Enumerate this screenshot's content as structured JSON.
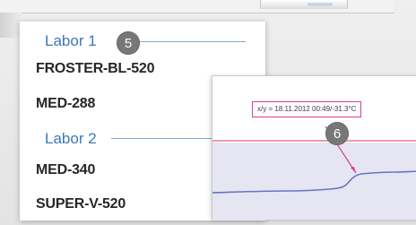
{
  "groups": [
    {
      "label": "Labor 1",
      "items": [
        "FROSTER-BL-520",
        "MED-288"
      ]
    },
    {
      "label": "Labor 2",
      "items": [
        "MED-340",
        "SUPER-V-520"
      ]
    }
  ],
  "callouts": [
    "5",
    "6"
  ],
  "chart": {
    "tooltip": "x/y = 18.11.2012 00:49/-31.3°C",
    "colors": {
      "limit_line": "#e87a86",
      "curve": "#6a74c0",
      "fill": "#e6e6f3",
      "pointer": "#d73f93",
      "grid": "#d8d8e6"
    }
  }
}
